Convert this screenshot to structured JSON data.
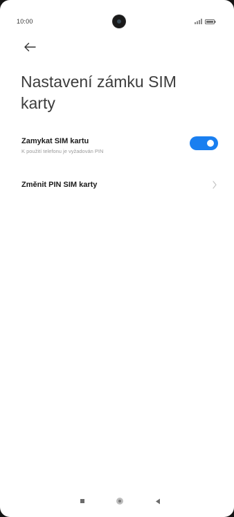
{
  "status_bar": {
    "time": "10:00",
    "icons": [
      "camera-icon",
      "signal-icon",
      "battery-icon"
    ]
  },
  "header": {
    "back_icon": "arrow-left-icon",
    "title": "Nastavení zámku SIM karty"
  },
  "settings": [
    {
      "title": "Zamykat SIM kartu",
      "subtitle": "K použití telefonu je vyžadován PIN",
      "control": "toggle",
      "enabled": true
    },
    {
      "title": "Změnit PIN SIM karty",
      "control": "chevron-right-icon"
    }
  ],
  "nav_bar": {
    "buttons": [
      "recents-icon",
      "home-icon",
      "back-triangle-icon"
    ]
  },
  "colors": {
    "accent": "#1a7ff0",
    "title_text": "#3c3c3c",
    "row_title": "#1b1b1b",
    "subtitle": "#9a9a9a",
    "background": "#ffffff"
  }
}
